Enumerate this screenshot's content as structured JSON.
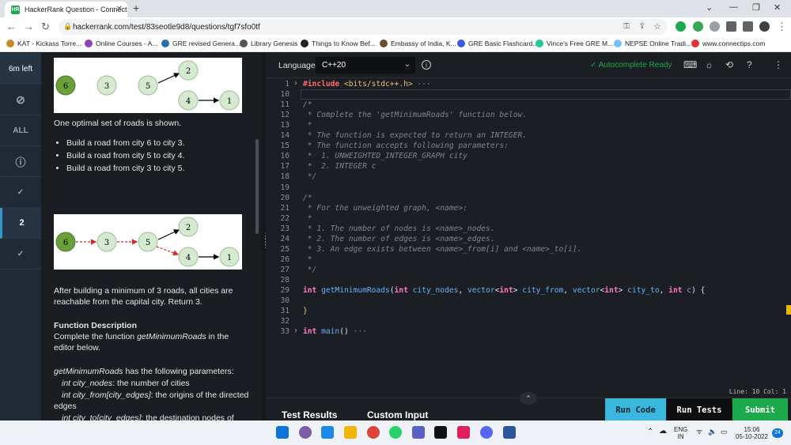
{
  "browser": {
    "tab_title": "HackerRank Question - Connect",
    "favicon_text": "HR",
    "url": "hackerrank.com/test/83seotle9d8/questions/tgf7sfo0tf",
    "bookmarks": [
      "KAT - Kickass Torre...",
      "Online Courses - A...",
      "GRE revised Genera...",
      "Library Genesis",
      "Things to Know Bef...",
      "Embassy of India, K...",
      "GRE Basic Flashcard...",
      "Vince's Free GRE M...",
      "NEPSE Online Tradi...",
      "www.connectips.com"
    ]
  },
  "leftnav": {
    "timer": "6m left",
    "items": [
      "compass-icon",
      "ALL",
      "info-icon",
      "check-icon",
      "2",
      "check-icon"
    ]
  },
  "problem": {
    "text1": "One optimal set of roads is shown.",
    "bullets": [
      "Build a road from city 6 to city 3.",
      "Build a road from city 5 to city 4.",
      "Build a road from city 3 to city 5."
    ],
    "text2": "After building a minimum of 3 roads, all cities are reachable from the capital city. Return 3.",
    "func_heading": "Function Description",
    "func_desc_pre": "Complete the function ",
    "func_name": "getMinimumRoads",
    "func_desc_post": " in the editor below.",
    "params_intro_post": " has the following parameters:",
    "params": [
      {
        "name": "int city_nodes",
        "desc": ": the number of cities"
      },
      {
        "name": "int city_from[city_edges]",
        "desc": ": the origins of the directed edges"
      },
      {
        "name": "int city_to[city_edges]",
        "desc": ": the destination nodes of"
      }
    ],
    "graph_nodes": [
      "6",
      "3",
      "5",
      "2",
      "4",
      "1"
    ]
  },
  "editor": {
    "language_label": "Language",
    "language": "C++20",
    "autocomplete": "Autocomplete Ready",
    "status": "Line: 10 Col: 1",
    "code_lines": [
      {
        "n": "1",
        "fold": "›",
        "parts": [
          [
            "pp",
            "#include "
          ],
          [
            "inc",
            "<bits/stdc++.h>"
          ],
          [
            "cm",
            " ···"
          ]
        ]
      },
      {
        "n": "10",
        "fold": "",
        "parts": []
      },
      {
        "n": "11",
        "fold": "",
        "parts": [
          [
            "cm",
            "/*"
          ]
        ]
      },
      {
        "n": "12",
        "fold": "",
        "parts": [
          [
            "cm",
            " * Complete the 'getMinimumRoads' function below."
          ]
        ]
      },
      {
        "n": "13",
        "fold": "",
        "parts": [
          [
            "cm",
            " *"
          ]
        ]
      },
      {
        "n": "14",
        "fold": "",
        "parts": [
          [
            "cm",
            " * The function is expected to return an INTEGER."
          ]
        ]
      },
      {
        "n": "15",
        "fold": "",
        "parts": [
          [
            "cm",
            " * The function accepts following parameters:"
          ]
        ]
      },
      {
        "n": "16",
        "fold": "",
        "parts": [
          [
            "cm",
            " *  1. UNWEIGHTED_INTEGER_GRAPH city"
          ]
        ]
      },
      {
        "n": "17",
        "fold": "",
        "parts": [
          [
            "cm",
            " *  2. INTEGER c"
          ]
        ]
      },
      {
        "n": "18",
        "fold": "",
        "parts": [
          [
            "cm",
            " */"
          ]
        ]
      },
      {
        "n": "19",
        "fold": "",
        "parts": []
      },
      {
        "n": "20",
        "fold": "",
        "parts": [
          [
            "cm",
            "/*"
          ]
        ]
      },
      {
        "n": "21",
        "fold": "",
        "parts": [
          [
            "cm",
            " * For the unweighted graph, <name>:"
          ]
        ]
      },
      {
        "n": "22",
        "fold": "",
        "parts": [
          [
            "cm",
            " *"
          ]
        ]
      },
      {
        "n": "23",
        "fold": "",
        "parts": [
          [
            "cm",
            " * 1. The number of nodes is <name>_nodes."
          ]
        ]
      },
      {
        "n": "24",
        "fold": "",
        "parts": [
          [
            "cm",
            " * 2. The number of edges is <name>_edges."
          ]
        ]
      },
      {
        "n": "25",
        "fold": "",
        "parts": [
          [
            "cm",
            " * 3. An edge exists between <name>_from[i] and <name>_to[i]."
          ]
        ]
      },
      {
        "n": "26",
        "fold": "",
        "parts": [
          [
            "cm",
            " *"
          ]
        ]
      },
      {
        "n": "27",
        "fold": "",
        "parts": [
          [
            "cm",
            " */"
          ]
        ]
      },
      {
        "n": "28",
        "fold": "",
        "parts": []
      },
      {
        "n": "29",
        "fold": "",
        "parts": [
          [
            "ty",
            "int"
          ],
          [
            "pl",
            " "
          ],
          [
            "fn",
            "getMinimumRoads"
          ],
          [
            "pl",
            "("
          ],
          [
            "ty",
            "int"
          ],
          [
            "pl",
            " "
          ],
          [
            "id",
            "city_nodes"
          ],
          [
            "pl",
            ", "
          ],
          [
            "id",
            "vector"
          ],
          [
            "pl",
            "<"
          ],
          [
            "ty",
            "int"
          ],
          [
            "pl",
            "> "
          ],
          [
            "id",
            "city_from"
          ],
          [
            "pl",
            ", "
          ],
          [
            "id",
            "vector"
          ],
          [
            "pl",
            "<"
          ],
          [
            "ty",
            "int"
          ],
          [
            "pl",
            "> "
          ],
          [
            "id",
            "city_to"
          ],
          [
            "pl",
            ", "
          ],
          [
            "ty",
            "int"
          ],
          [
            "pl",
            " "
          ],
          [
            "id",
            "c"
          ],
          [
            "pl",
            ") {"
          ]
        ]
      },
      {
        "n": "30",
        "fold": "",
        "parts": []
      },
      {
        "n": "31",
        "fold": "",
        "parts": [
          [
            "inc",
            "}"
          ]
        ]
      },
      {
        "n": "32",
        "fold": "",
        "parts": []
      },
      {
        "n": "33",
        "fold": "›",
        "parts": [
          [
            "ty",
            "int"
          ],
          [
            "pl",
            " "
          ],
          [
            "fn",
            "main"
          ],
          [
            "pl",
            "()"
          ],
          [
            "cm",
            " ···"
          ]
        ]
      }
    ]
  },
  "bottom": {
    "test_results": "Test Results",
    "custom_input": "Custom Input",
    "run_code": "Run Code",
    "run_tests": "Run Tests",
    "submit": "Submit"
  },
  "taskbar": {
    "lang1": "ENG",
    "lang2": "IN",
    "time": "15:06",
    "date": "05-10-2022",
    "badge": "24"
  },
  "colors": {
    "accent_green": "#1ba94c",
    "node_green": "#6a9f3a",
    "node_light": "#d6ead1",
    "run_code_bg": "#39b7dd"
  }
}
